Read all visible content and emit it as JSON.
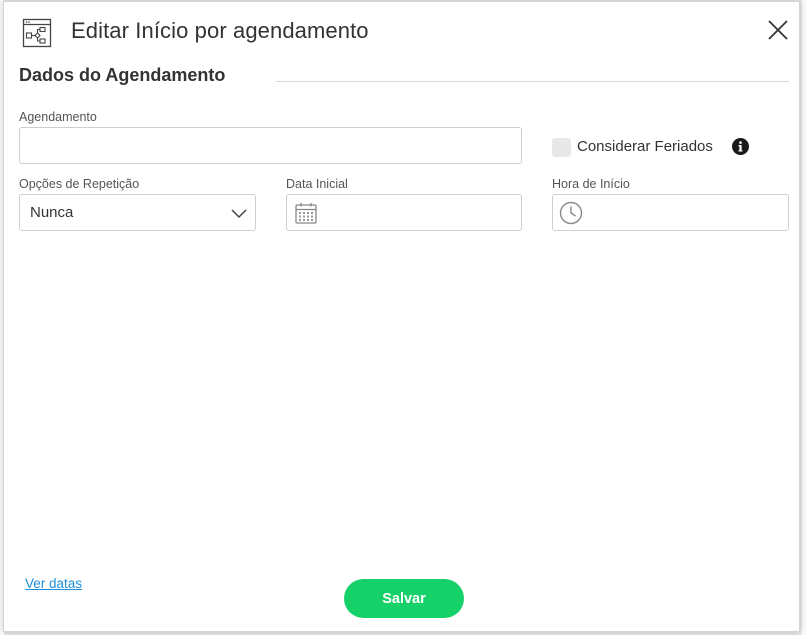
{
  "dialog": {
    "title": "Editar Início por agendamento",
    "section_title": "Dados do Agendamento",
    "icon": "flowchart-icon"
  },
  "fields": {
    "agendamento": {
      "label": "Agendamento",
      "value": ""
    },
    "consider_holidays": {
      "label": "Considerar Feriados",
      "checked": false
    },
    "repeat_options": {
      "label": "Opções de Repetição",
      "value": "Nunca"
    },
    "start_date": {
      "label": "Data Inicial",
      "value": ""
    },
    "start_time": {
      "label": "Hora de Início",
      "value": ""
    }
  },
  "footer": {
    "link_label": "Ver datas",
    "save_label": "Salvar"
  },
  "colors": {
    "save_button": "#16d06a",
    "link": "#1f8fd8",
    "text": "#333333"
  }
}
